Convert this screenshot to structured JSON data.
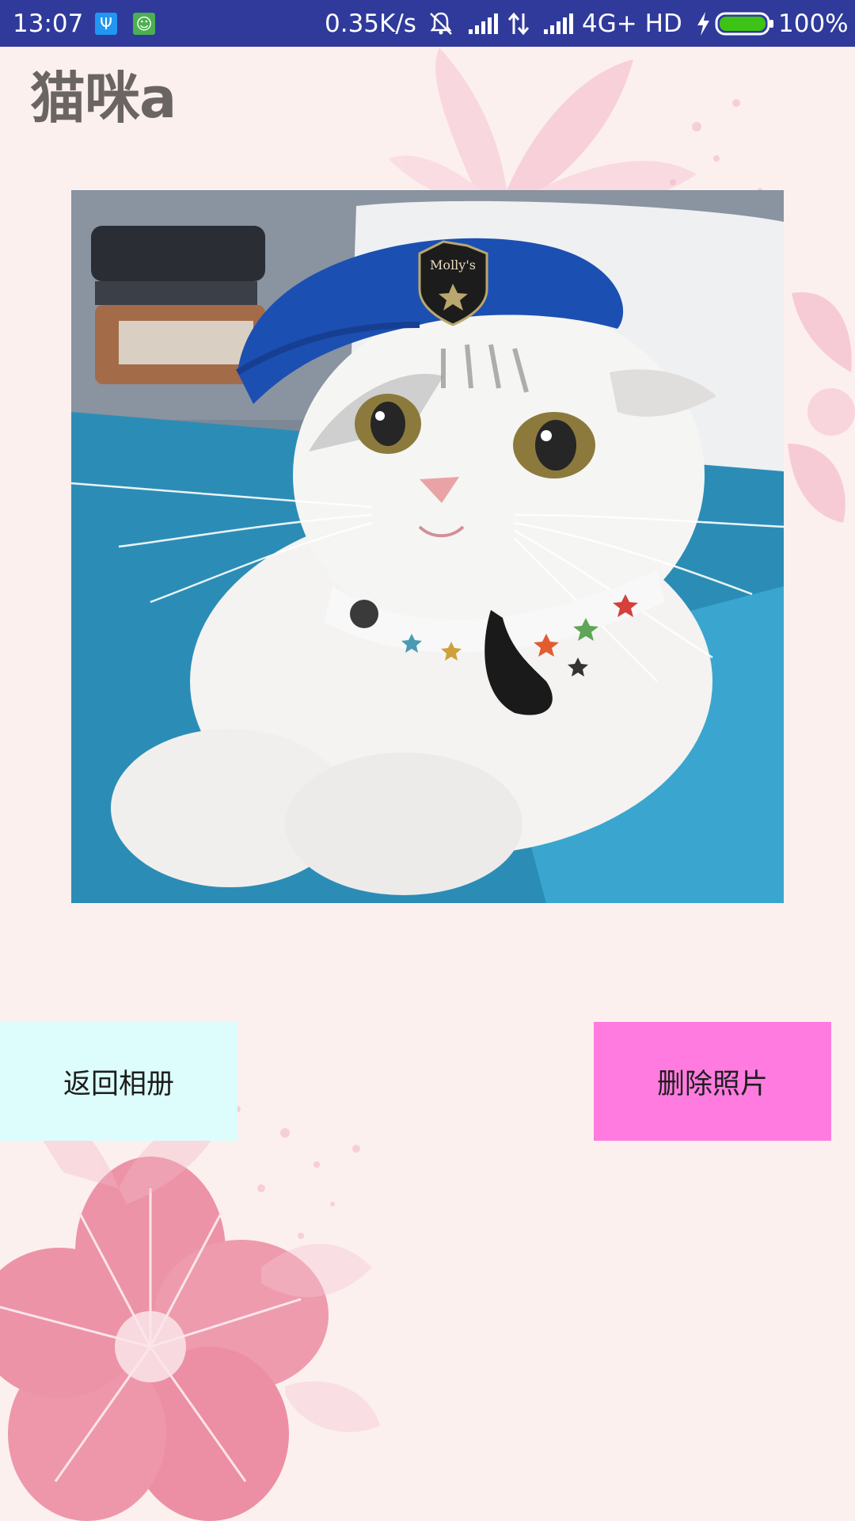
{
  "status_bar": {
    "time": "13:07",
    "network_speed": "0.35K/s",
    "network_type": "4G+ HD",
    "battery": "100%",
    "icons": [
      "usb-icon",
      "android-icon",
      "mute-bell-icon",
      "signal-icon",
      "data-arrows-icon",
      "signal-icon",
      "charging-icon",
      "battery-icon"
    ],
    "battery_color": "#3cc316"
  },
  "page": {
    "title": "猫咪a"
  },
  "photo": {
    "badge_text": "Molly's"
  },
  "buttons": {
    "back_label": "返回相册",
    "delete_label": "删除照片"
  },
  "colors": {
    "status_bar": "#2f3a9b",
    "back_button": "#dcfdfb",
    "delete_button": "#ff7be0",
    "background": "#fcf0ee",
    "title": "#6a6563"
  }
}
